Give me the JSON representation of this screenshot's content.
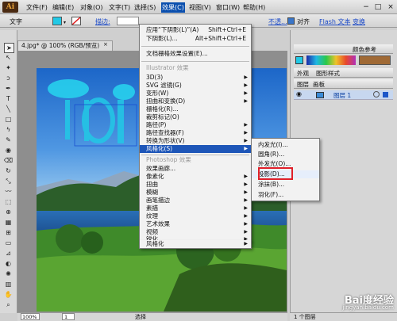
{
  "app": {
    "logo": "Ai"
  },
  "menubar": [
    "文件(F)",
    "编辑(E)",
    "对象(O)",
    "文字(T)",
    "选择(S)",
    "效果(C)",
    "视图(V)",
    "窗口(W)",
    "帮助(H)"
  ],
  "window_controls": {
    "minimize": "−",
    "maximize": "□",
    "close": "×"
  },
  "toolbar": {
    "type_label": "文字",
    "stroke_label": "描边:",
    "opacity_label": "不透...",
    "align_label": "对齐",
    "flash_label": "Flash 文本",
    "transform_label": "变换"
  },
  "document": {
    "tab_title": "4.jpg* @ 100% (RGB/预览)"
  },
  "effect_menu": {
    "apply_last": "应用“下阴影(L)”(A)",
    "apply_last_shortcut": "Shift+Ctrl+E",
    "last_effect": "下阴影(L)...",
    "last_effect_shortcut": "Alt+Shift+Ctrl+E",
    "raster_settings": "文档栅格效果设置(E)...",
    "illustrator_header": "Illustrator 效果",
    "illustrator_items": [
      "3D(3)",
      "SVG 滤镜(G)",
      "变形(W)",
      "扭曲和变换(D)",
      "栅格化(R)...",
      "裁剪标记(O)",
      "路径(P)",
      "路径查找器(F)",
      "转换为形状(V)",
      "风格化(S)"
    ],
    "photoshop_header": "Photoshop 效果",
    "photoshop_items": [
      "效果画廊...",
      "像素化",
      "扭曲",
      "模糊",
      "画笔描边",
      "素描",
      "纹理",
      "艺术效果",
      "视频",
      "锐化",
      "风格化"
    ]
  },
  "stylize_submenu": {
    "items": [
      "内发光(I)...",
      "圆角(R)...",
      "外发光(O)...",
      "投影(D)...",
      "涂抹(B)...",
      "羽化(F)..."
    ],
    "highlighted": "投影(D)..."
  },
  "right_panel": {
    "tabs_top": [
      "外观",
      "图形样式"
    ],
    "color_ref": "颜色参考",
    "layers_tab": "图层",
    "artboard_tab": "画板",
    "layer_name": "图层 1",
    "footer": "1 个图层"
  },
  "statusbar": {
    "zoom": "100%",
    "page": "1",
    "mode": "选择"
  },
  "watermark": {
    "brand": "Bai度",
    "suffix": "经验",
    "url": "jingyan.baidu.com"
  },
  "colors": {
    "menu_highlight": "#1e56b8",
    "annotation_box": "#e0202a",
    "fill_swatch": "#22c9e6"
  }
}
